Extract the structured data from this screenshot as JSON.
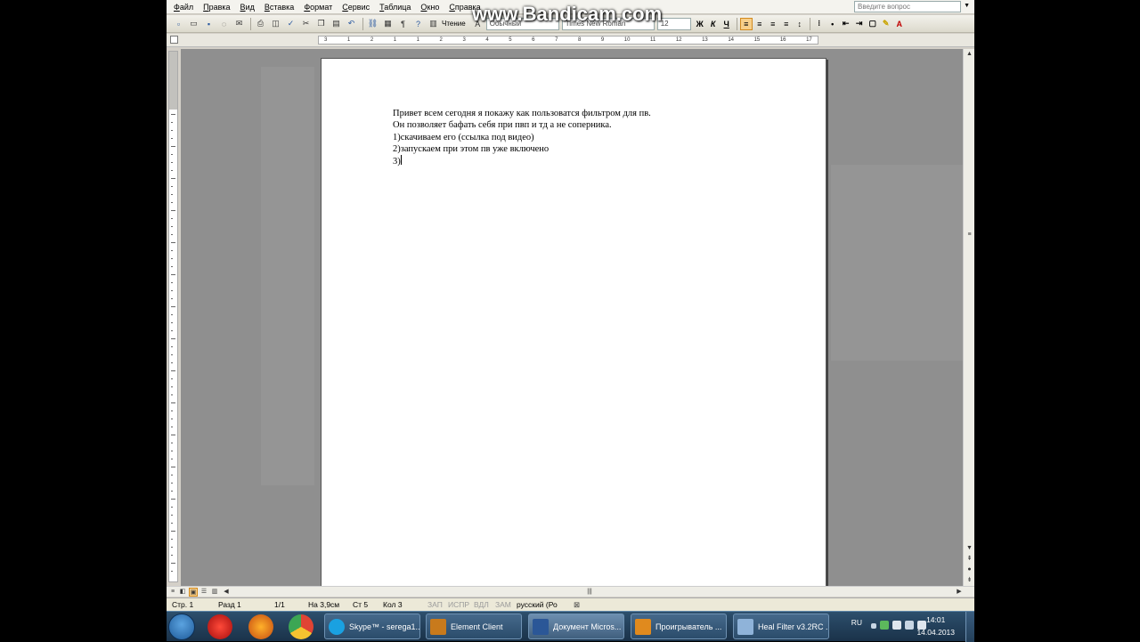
{
  "menu": {
    "items": [
      "Файл",
      "Правка",
      "Вид",
      "Вставка",
      "Формат",
      "Сервис",
      "Таблица",
      "Окно",
      "Справка"
    ],
    "help_placeholder": "Введите вопрос"
  },
  "toolbar": {
    "reading_label": "Чтение",
    "style": "Обычный",
    "font": "Times New Roman",
    "size": "12",
    "bold": "Ж",
    "italic": "К",
    "underline": "Ч"
  },
  "watermark": "www.Bandicam.com",
  "ruler": {
    "numbers": [
      "3",
      "1",
      "2",
      "1",
      "1",
      "2",
      "3",
      "4",
      "5",
      "6",
      "7",
      "8",
      "9",
      "10",
      "11",
      "12",
      "13",
      "14",
      "15",
      "16",
      "17"
    ]
  },
  "document": {
    "lines": [
      "Привет всем сегодня я покажу как пользоватся фильтром для пв.",
      "Он позволяет бафать себя при пвп и тд а не соперника.",
      "1)скачиваем его (ссылка под видео)",
      "2)запускаем при этом пв уже включено",
      "3)"
    ]
  },
  "status": {
    "page": "Стр. 1",
    "section": "Разд 1",
    "pages": "1/1",
    "at": "На 3,9см",
    "line": "Ст 5",
    "col": "Кол 3",
    "rec": "ЗАП",
    "trk": "ИСПР",
    "ext": "ВДЛ",
    "ovr": "ЗАМ",
    "lang": "русский (Ро"
  },
  "taskbar": {
    "tasks": [
      {
        "label": "Skype™ - serega1...",
        "color": "#1aa1e1"
      },
      {
        "label": "Element Client",
        "color": "#c87a1c"
      },
      {
        "label": "Документ Micros...",
        "color": "#2b5797"
      },
      {
        "label": "Проигрыватель ...",
        "color": "#e08a1e"
      },
      {
        "label": "Heal Filter v3.2RC ...",
        "color": "#8fb3d9"
      }
    ],
    "lang": "RU",
    "time": "14:01",
    "date": "14.04.2013"
  }
}
